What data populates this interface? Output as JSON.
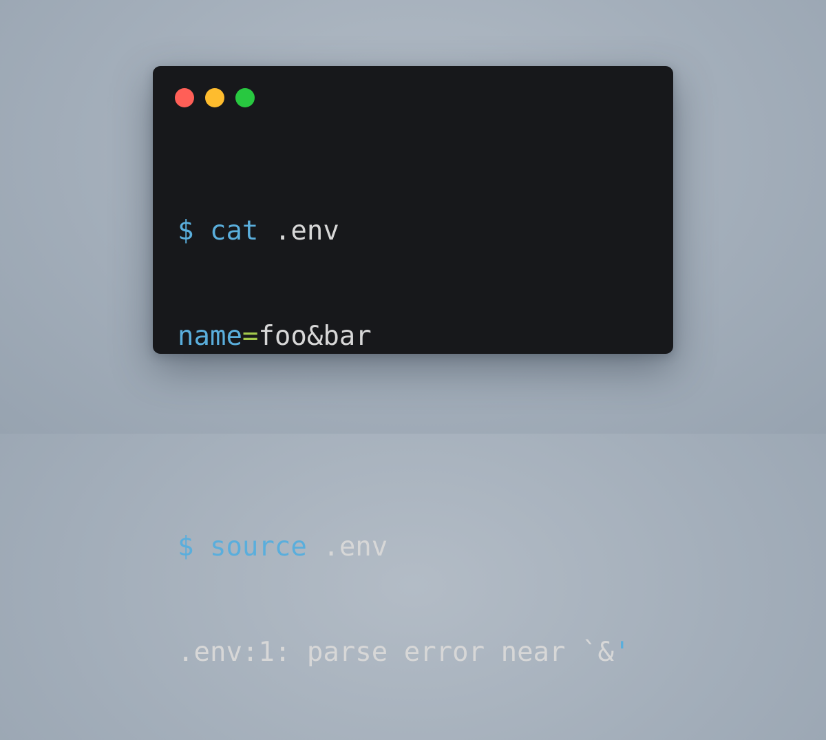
{
  "colors": {
    "background": "#a3aeba",
    "terminal_bg": "#17181b",
    "text": "#d7d7d7",
    "command": "#5aaedc",
    "operator": "#a3c94b",
    "close_dot": "#ff5f57",
    "minimize_dot": "#febc2e",
    "maximize_dot": "#28c840"
  },
  "window_controls": [
    "close-dot",
    "minimize-dot",
    "maximize-dot"
  ],
  "lines": {
    "cat": {
      "prompt": "$",
      "command": "cat",
      "arg": ".env"
    },
    "env_content": {
      "key": "name",
      "eq": "=",
      "value": "foo&bar"
    },
    "source": {
      "prompt": "$",
      "command": "source",
      "arg": ".env"
    },
    "error": {
      "message": ".env:1: parse error near `&",
      "quote": "'"
    }
  }
}
